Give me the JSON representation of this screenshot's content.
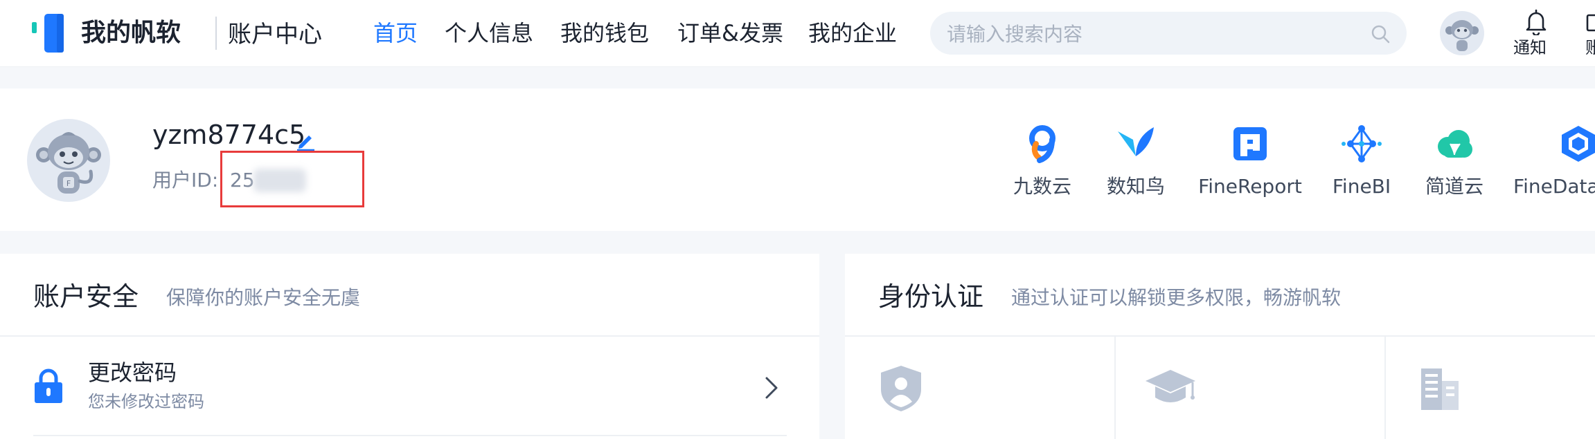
{
  "header": {
    "brand": "我的帆软",
    "subtitle": "账户中心",
    "nav": [
      {
        "label": "首页",
        "active": true
      },
      {
        "label": "个人信息"
      },
      {
        "label": "我的钱包"
      },
      {
        "label": "订单&发票"
      },
      {
        "label": "我的企业"
      }
    ],
    "search": {
      "placeholder": "请输入搜索内容",
      "icon": "search-icon"
    },
    "notify_label": "通知",
    "cut_label": "账"
  },
  "profile": {
    "username": "yzm8774c5",
    "uid_label": "用户ID:",
    "uid_value_visible": "25",
    "products": [
      {
        "label": "九数云",
        "icon": "jiushuyun-icon"
      },
      {
        "label": "数知鸟",
        "icon": "shuzhiniao-icon"
      },
      {
        "label": "FineReport",
        "icon": "finereport-icon"
      },
      {
        "label": "FineBI",
        "icon": "finebi-icon"
      },
      {
        "label": "简道云",
        "icon": "jiandaoyun-icon"
      },
      {
        "label": "FineData",
        "icon": "finedata-icon"
      }
    ]
  },
  "security": {
    "title": "账户安全",
    "subtitle": "保障你的账户安全无虞",
    "rows": [
      {
        "title": "更改密码",
        "desc": "您未修改过密码"
      }
    ]
  },
  "identity": {
    "title": "身份认证",
    "subtitle": "通过认证可以解锁更多权限，畅游帆软"
  },
  "colors": {
    "accent": "#1f78ff",
    "highlight": "#e83b3b",
    "muted": "#7d8aa3"
  }
}
